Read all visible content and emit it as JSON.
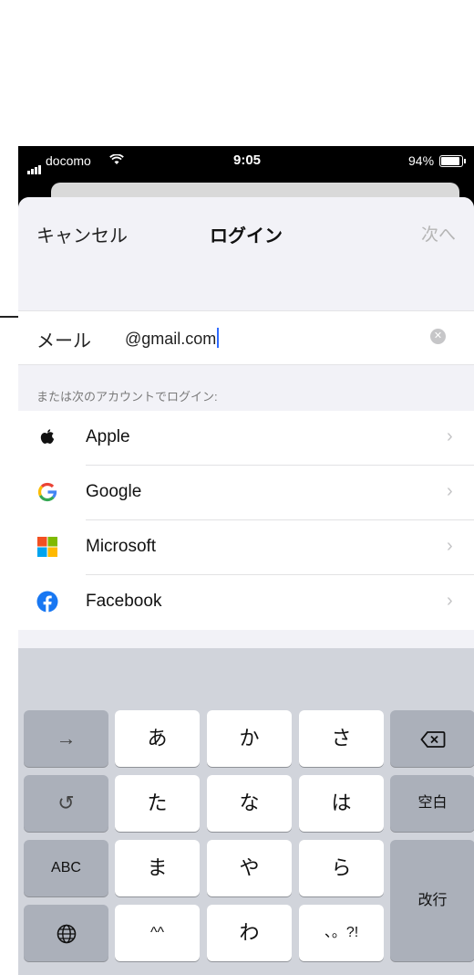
{
  "status_bar": {
    "carrier": "docomo",
    "time": "9:05",
    "battery": "94%",
    "wifi_icon": "wifi-icon"
  },
  "nav": {
    "cancel": "キャンセル",
    "title": "ログイン",
    "next": "次へ"
  },
  "email": {
    "label": "メール",
    "value": "@gmail.com"
  },
  "section_header": "または次のアカウントでログイン:",
  "providers": [
    {
      "label": "Apple",
      "icon": "apple-logo-icon"
    },
    {
      "label": "Google",
      "icon": "google-logo-icon"
    },
    {
      "label": "Microsoft",
      "icon": "microsoft-logo-icon"
    },
    {
      "label": "Facebook",
      "icon": "facebook-logo-icon"
    }
  ],
  "keyboard": {
    "arrow": "→",
    "undo": "↺",
    "abc": "ABC",
    "globe_icon": "globe-icon",
    "a": "あ",
    "ka": "か",
    "sa": "さ",
    "ta": "た",
    "na": "な",
    "ha": "は",
    "ma": "ま",
    "ya": "や",
    "ra": "ら",
    "emoticon": "^^",
    "wa": "わ",
    "punct": "、。?!",
    "delete_icon": "delete-icon",
    "space": "空白",
    "return": "改行"
  },
  "colors": {
    "link_blue": "#2f6bff",
    "facebook_blue": "#1877f2"
  }
}
